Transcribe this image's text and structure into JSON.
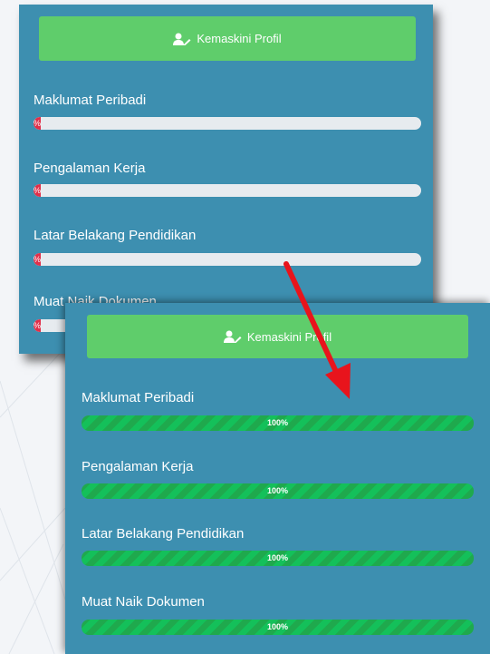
{
  "before": {
    "button_label": "Kemaskini Profil",
    "sections": [
      {
        "label": "Maklumat Peribadi",
        "progress_text": "%"
      },
      {
        "label": "Pengalaman Kerja",
        "progress_text": "%"
      },
      {
        "label": "Latar Belakang Pendidikan",
        "progress_text": "%"
      },
      {
        "label": "Muat Naik Dokumen",
        "progress_text": "%"
      }
    ]
  },
  "after": {
    "button_label": "Kemaskini Profil",
    "sections": [
      {
        "label": "Maklumat Peribadi",
        "progress_text": "100%"
      },
      {
        "label": "Pengalaman Kerja",
        "progress_text": "100%"
      },
      {
        "label": "Latar Belakang Pendidikan",
        "progress_text": "100%"
      },
      {
        "label": "Muat Naik Dokumen",
        "progress_text": "100%"
      }
    ]
  },
  "icons": {
    "button_icon": "user-edit-icon",
    "annotation": "red-arrow-icon"
  },
  "colors": {
    "panel": "#3d8fb0",
    "button": "#5fcd6b",
    "empty_fill": "#e0304a",
    "full_fill": "#1fa94d",
    "arrow": "#e8141c"
  }
}
